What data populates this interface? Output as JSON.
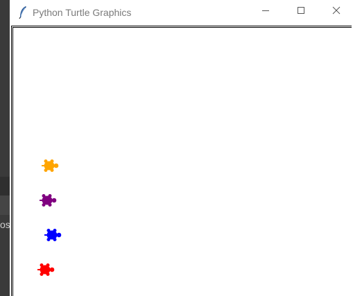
{
  "window": {
    "title": "Python Turtle Graphics",
    "icon": "feather-icon",
    "controls": {
      "minimize": "minimize-icon",
      "maximize": "maximize-icon",
      "close": "close-icon"
    }
  },
  "background_app": {
    "partial_text": "os"
  },
  "turtles": [
    {
      "color": "#ffa500",
      "label": "orange"
    },
    {
      "color": "#800080",
      "label": "purple"
    },
    {
      "color": "#0000ff",
      "label": "blue"
    },
    {
      "color": "#ff0000",
      "label": "red"
    }
  ]
}
